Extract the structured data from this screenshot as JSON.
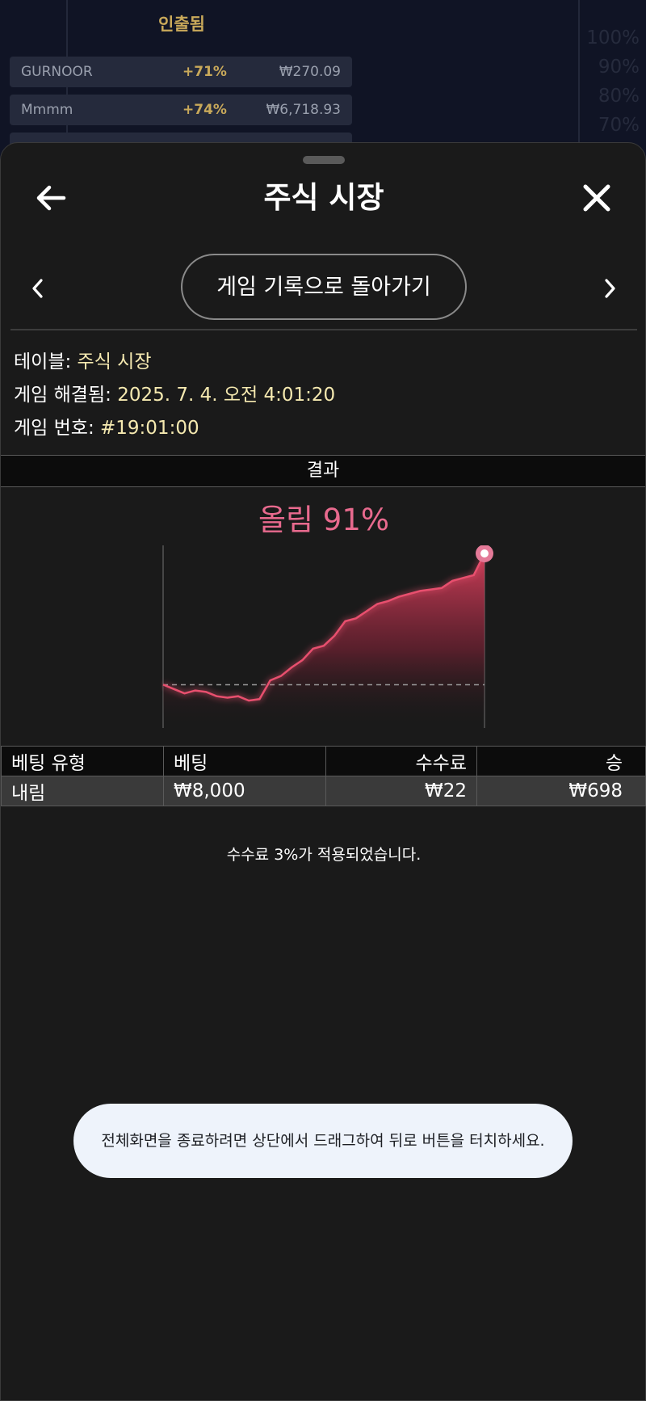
{
  "background": {
    "title": "인출됨",
    "rows": [
      {
        "name": "GURNOOR",
        "percent": "+71%",
        "amount": "₩270.09"
      },
      {
        "name": "Mmmm",
        "percent": "+74%",
        "amount": "₩6,718.93"
      }
    ],
    "scale_labels": [
      "100%",
      "90%",
      "80%",
      "70%"
    ]
  },
  "header": {
    "title": "주식 시장",
    "back_icon": "arrow-left-icon",
    "close_icon": "close-icon"
  },
  "nav": {
    "history_label": "게임 기록으로 돌아가기",
    "prev_icon": "chevron-left-icon",
    "next_icon": "chevron-right-icon"
  },
  "info": {
    "table_label": "테이블:",
    "table_value": "주식 시장",
    "resolved_label": "게임 해결됨:",
    "resolved_value": "2025. 7. 4. 오전 4:01:20",
    "number_label": "게임 번호:",
    "number_value": "#19:01:00"
  },
  "result": {
    "header": "결과",
    "label": "올림 91%",
    "color": "#e86a8e"
  },
  "chart_data": {
    "type": "area",
    "y_percent": [
      0,
      -3,
      -6,
      -4,
      -5,
      -8,
      -9,
      -8,
      -11,
      -10,
      3,
      6,
      12,
      17,
      25,
      27,
      34,
      44,
      46,
      51,
      56,
      58,
      61,
      63,
      65,
      66,
      67,
      72,
      74,
      76
    ],
    "ylim": [
      -30,
      91
    ],
    "baseline": 0,
    "final_value": 91,
    "line_color": "#e8506e",
    "fill_color": "#c8354f"
  },
  "bets": {
    "headers": [
      "베팅 유형",
      "베팅",
      "수수료",
      "승"
    ],
    "rows": [
      [
        "내림",
        "₩8,000",
        "₩22",
        "₩698"
      ]
    ]
  },
  "fee_note": "수수료 3%가 적용되었습니다.",
  "toast": "전체화면을 종료하려면 상단에서 드래그하여 뒤로 버튼을 터치하세요."
}
